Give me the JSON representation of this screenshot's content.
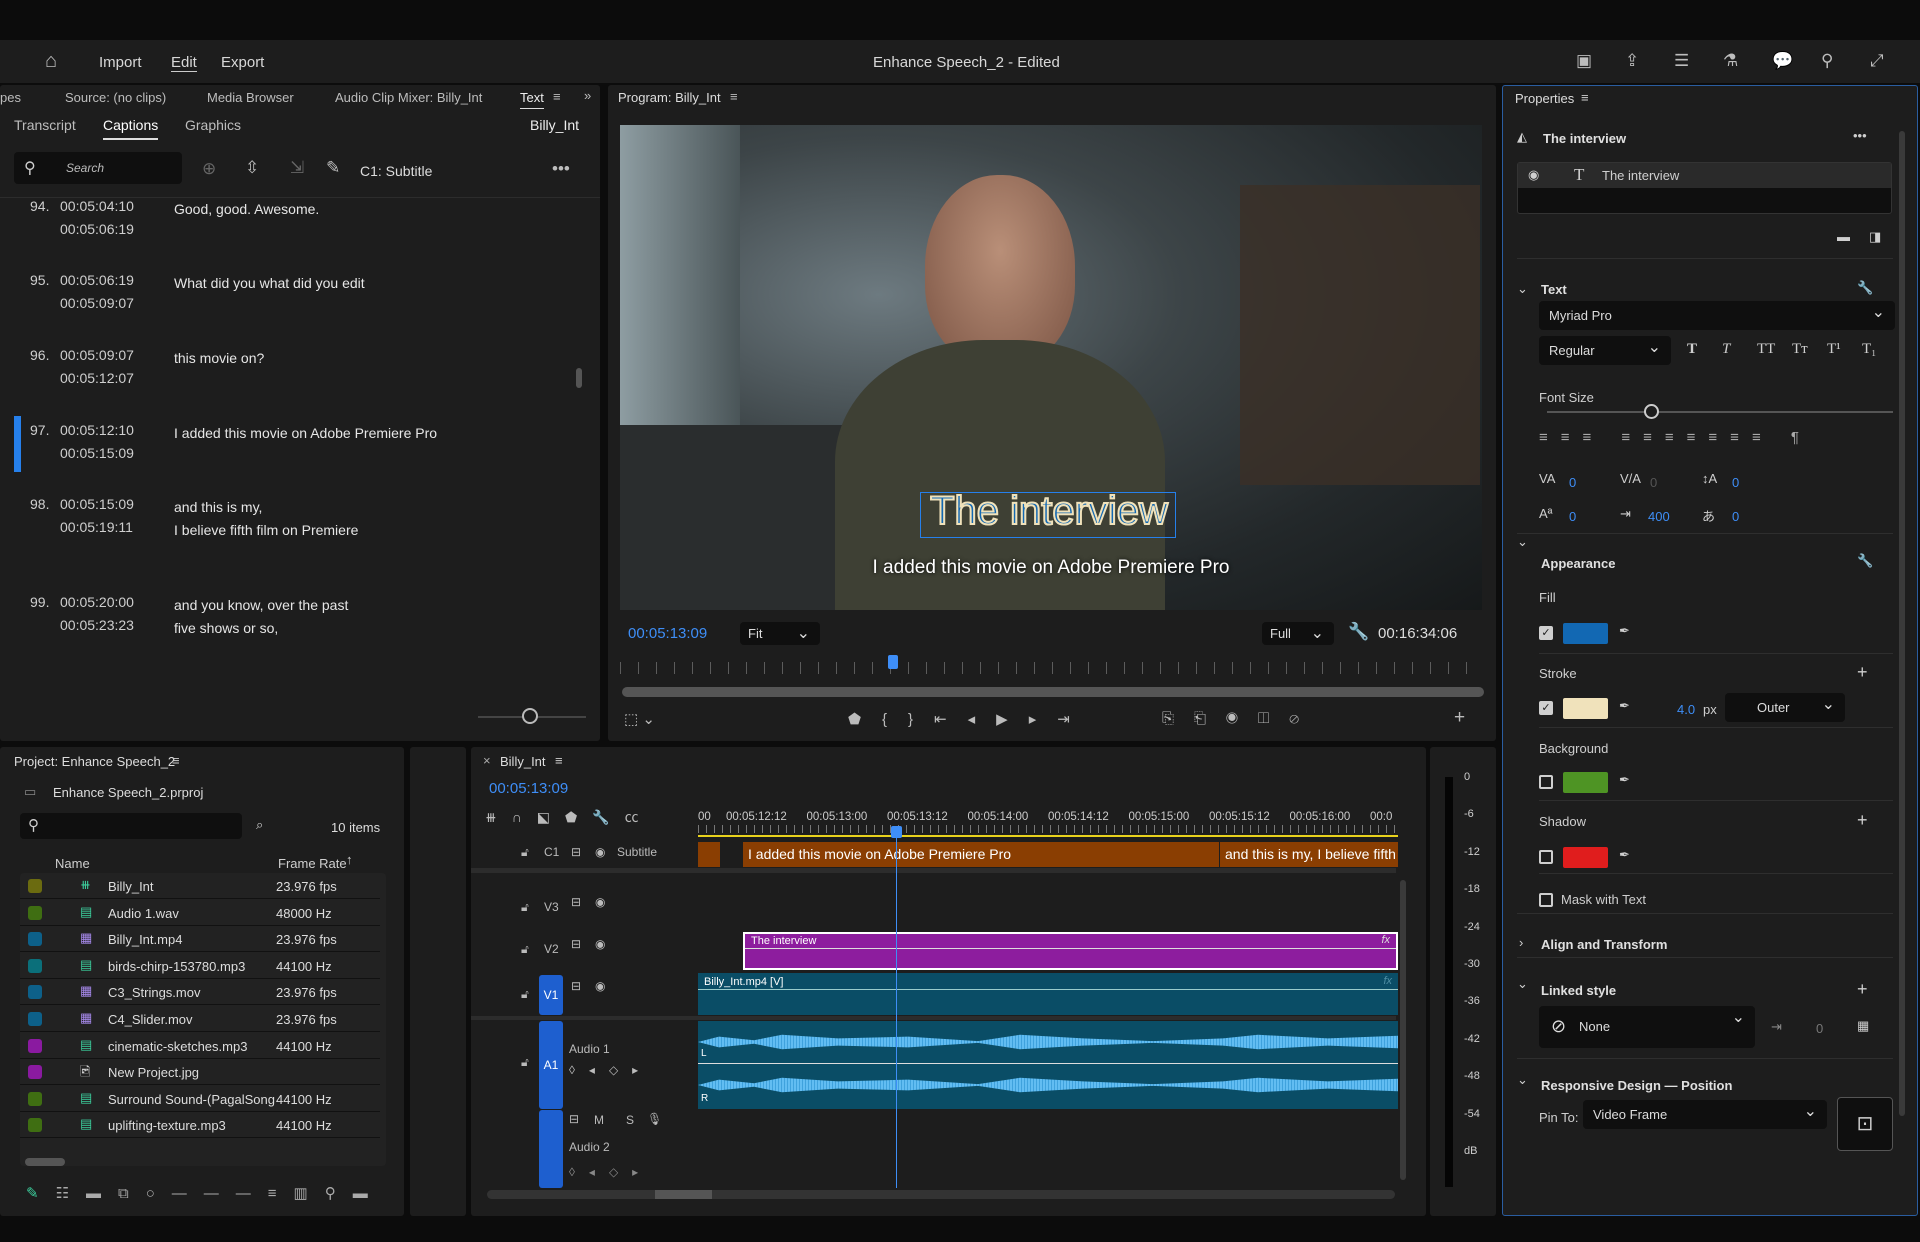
{
  "menu": {
    "home_icon": "home-icon",
    "import": "Import",
    "edit": "Edit",
    "export": "Export",
    "title": "Enhance Speech_2 - Edited"
  },
  "left_panel": {
    "tabs": [
      "pes",
      "Source: (no clips)",
      "Media Browser",
      "Audio Clip Mixer: Billy_Int",
      "Text"
    ],
    "subtabs": [
      "Transcript",
      "Captions",
      "Graphics"
    ],
    "sequence": "Billy_Int",
    "search_placeholder": "Search",
    "track": "C1: Subtitle",
    "captions": [
      {
        "num": "94.",
        "in": "00:05:04:10",
        "out": "00:05:06:19",
        "text": "Good, good. Awesome."
      },
      {
        "num": "95.",
        "in": "00:05:06:19",
        "out": "00:05:09:07",
        "text": "What did you what did you edit"
      },
      {
        "num": "96.",
        "in": "00:05:09:07",
        "out": "00:05:12:07",
        "text": "this movie on?"
      },
      {
        "num": "97.",
        "in": "00:05:12:10",
        "out": "00:05:15:09",
        "text": "I added this movie on Adobe Premiere Pro",
        "selected": true
      },
      {
        "num": "98.",
        "in": "00:05:15:09",
        "out": "00:05:19:11",
        "text": "and this is my,\nI believe fifth film on Premiere"
      },
      {
        "num": "99.",
        "in": "00:05:20:00",
        "out": "00:05:23:23",
        "text": "and you know, over the past\nfive shows or so,"
      }
    ]
  },
  "program": {
    "title": "Program: Billy_Int",
    "graphic_text": "The interview",
    "subtitle": "I added this movie on Adobe Premiere Pro",
    "timecode": "00:05:13:09",
    "zoom": "Fit",
    "quality": "Full",
    "duration": "00:16:34:06"
  },
  "project": {
    "title": "Project: Enhance Speech_2",
    "file": "Enhance Speech_2.prproj",
    "count": "10 items",
    "col_name": "Name",
    "col_rate": "Frame Rate",
    "items": [
      {
        "name": "Billy_Int",
        "rate": "23.976 fps",
        "color": "#6b6b10",
        "icon": "sequence-icon"
      },
      {
        "name": "Audio 1.wav",
        "rate": "48000 Hz",
        "color": "#3f6e12",
        "icon": "audio-icon"
      },
      {
        "name": "Billy_Int.mp4",
        "rate": "23.976 fps",
        "color": "#0d6089",
        "icon": "video-icon"
      },
      {
        "name": "birds-chirp-153780.mp3",
        "rate": "44100 Hz",
        "color": "#0b6f7a",
        "icon": "audio-icon"
      },
      {
        "name": "C3_Strings.mov",
        "rate": "23.976 fps",
        "color": "#0d6089",
        "icon": "video-icon"
      },
      {
        "name": "C4_Slider.mov",
        "rate": "23.976 fps",
        "color": "#0d6089",
        "icon": "video-icon"
      },
      {
        "name": "cinematic-sketches.mp3",
        "rate": "44100 Hz",
        "color": "#8a1aa0",
        "icon": "audio-icon"
      },
      {
        "name": "New Project.jpg",
        "rate": "",
        "color": "#8a1aa0",
        "icon": "image-icon"
      },
      {
        "name": "Surround Sound-(PagalSong",
        "rate": "44100 Hz",
        "color": "#3f6e12",
        "icon": "audio-icon"
      },
      {
        "name": "uplifting-texture.mp3",
        "rate": "44100 Hz",
        "color": "#3f6e12",
        "icon": "audio-icon"
      }
    ]
  },
  "timeline": {
    "title": "Billy_Int",
    "timecode": "00:05:13:09",
    "ruler": [
      "00",
      "00:05:12:12",
      "00:05:13:00",
      "00:05:13:12",
      "00:05:14:00",
      "00:05:14:12",
      "00:05:15:00",
      "00:05:15:12",
      "00:05:16:00",
      "00:0"
    ],
    "tracks": {
      "c1": "C1",
      "c1_name": "Subtitle",
      "v3": "V3",
      "v2": "V2",
      "v1": "V1",
      "a1": "A1",
      "a1_name": "Audio 1",
      "a2_name": "Audio 2",
      "m": "M",
      "s": "S"
    },
    "clips": {
      "cap1": "I added this movie on Adobe Premiere Pro",
      "cap2": "and this is my, I believe fifth",
      "graphic": "The interview",
      "video": "Billy_Int.mp4 [V]",
      "fx": "fx",
      "l": "L",
      "r": "R"
    }
  },
  "meter": {
    "ticks": [
      "0",
      "-6",
      "-12",
      "-18",
      "-24",
      "-30",
      "-36",
      "-42",
      "-48",
      "-54",
      "dB"
    ]
  },
  "properties": {
    "title": "Properties",
    "layer_group": "The interview",
    "layer": "The interview",
    "text_section": "Text",
    "font": "Myriad Pro",
    "style": "Regular",
    "font_size_label": "Font Size",
    "font_size_fraction": 0.3,
    "style_buttons": [
      "T",
      "T",
      "TT",
      "Tт",
      "T¹",
      "T₁"
    ],
    "kerning": "0",
    "tracking": "0",
    "leading": "0",
    "baseline": "0",
    "tab_width": "400",
    "tsume": "0",
    "appearance": "Appearance",
    "fill": "Fill",
    "fill_color": "#1268b3",
    "stroke": "Stroke",
    "stroke_color": "#f0e2bb",
    "stroke_width": "4.0",
    "stroke_unit": "px",
    "stroke_pos": "Outer",
    "background": "Background",
    "background_color": "#4e9424",
    "shadow": "Shadow",
    "shadow_color": "#e01d1d",
    "mask": "Mask with Text",
    "align": "Align and Transform",
    "linked": "Linked style",
    "linked_value": "None",
    "linked_count": "0",
    "responsive": "Responsive Design — Position",
    "pin_to": "Pin To:",
    "pin_value": "Video Frame"
  }
}
